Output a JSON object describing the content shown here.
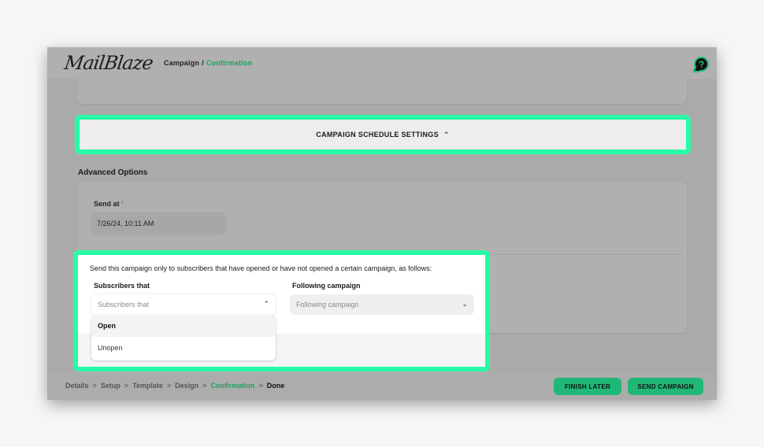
{
  "header": {
    "logo_text": "MailBlaze",
    "breadcrumb": {
      "parent": "Campaign",
      "separator": "/",
      "current": "Confirmation"
    },
    "help_icon": "help-chat-icon",
    "help_glyph": "?"
  },
  "schedule_section": {
    "label": "CAMPAIGN SCHEDULE SETTINGS",
    "chevron_glyph": "⌃",
    "chevron_icon": "chevron-up-icon"
  },
  "advanced_options": {
    "title": "Advanced Options",
    "send_at": {
      "label": "Send at",
      "required_mark": "*",
      "value": "7/26/24, 10:11 AM"
    },
    "subscriber_filter": {
      "description": "Send this campaign only to subscribers that have opened or have not opened a certain campaign, as follows:",
      "subscribers_that": {
        "label": "Subscribers that",
        "placeholder": "Subscribers that",
        "arrow_glyph": "⌃",
        "open": true,
        "options": [
          "Open",
          "Unopen"
        ],
        "hovered_option": "Open"
      },
      "following_campaign": {
        "label": "Following campaign",
        "placeholder": "Following campaign",
        "arrow_glyph": "⌄"
      }
    }
  },
  "footer": {
    "steps": [
      {
        "label": "Details",
        "state": "done"
      },
      {
        "label": "Setup",
        "state": "done"
      },
      {
        "label": "Template",
        "state": "done"
      },
      {
        "label": "Design",
        "state": "done"
      },
      {
        "label": "Confirmation",
        "state": "active"
      },
      {
        "label": "Done",
        "state": "next"
      }
    ],
    "step_separator": ">",
    "finish_later_label": "FINISH LATER",
    "send_campaign_label": "SEND CAMPAIGN"
  },
  "colors": {
    "accent_green": "#1e9e62",
    "button_green": "#1fb877",
    "highlight_green": "#28fba7",
    "overlay_gray": "#aaaaaa"
  }
}
